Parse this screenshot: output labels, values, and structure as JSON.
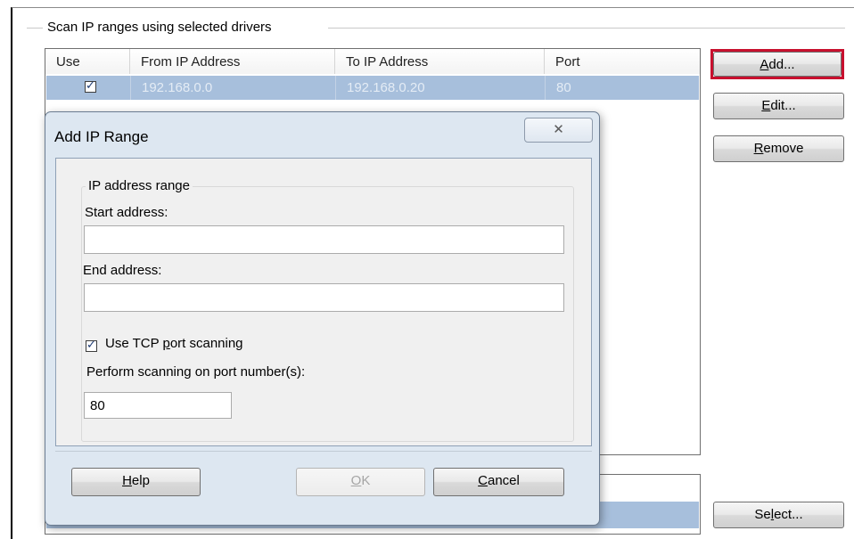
{
  "group": {
    "title": "Scan IP ranges using selected drivers"
  },
  "table": {
    "columns": [
      "Use",
      "From IP Address",
      "To IP Address",
      "Port"
    ],
    "rows": [
      {
        "use": true,
        "from": "192.168.0.0",
        "to": "192.168.0.20",
        "port": "80"
      }
    ]
  },
  "buttons": {
    "add": {
      "pre": "",
      "key": "A",
      "post": "dd..."
    },
    "edit": {
      "pre": "",
      "key": "E",
      "post": "dit..."
    },
    "remove": {
      "pre": "",
      "key": "R",
      "post": "emove"
    },
    "select": {
      "pre": "Se",
      "key": "l",
      "post": "ect..."
    }
  },
  "dialog": {
    "title": "Add IP Range",
    "close_glyph": "✕",
    "legend": "IP address range",
    "start_label": "Start address:",
    "start_value": "",
    "end_label": "End address:",
    "end_value": "",
    "tcp": {
      "checked": true,
      "pre": "Use TCP ",
      "key": "p",
      "post": "ort scanning"
    },
    "port_label": "Perform scanning on port number(s):",
    "port_value": "80",
    "help": {
      "pre": "",
      "key": "H",
      "post": "elp"
    },
    "ok": {
      "pre": "",
      "key": "O",
      "post": "K"
    },
    "cancel": {
      "pre": "",
      "key": "C",
      "post": "ancel"
    }
  },
  "colors": {
    "highlight": "#c8102e",
    "selection": "#a7bfdc",
    "dialog_frame": "#dde7f1"
  }
}
